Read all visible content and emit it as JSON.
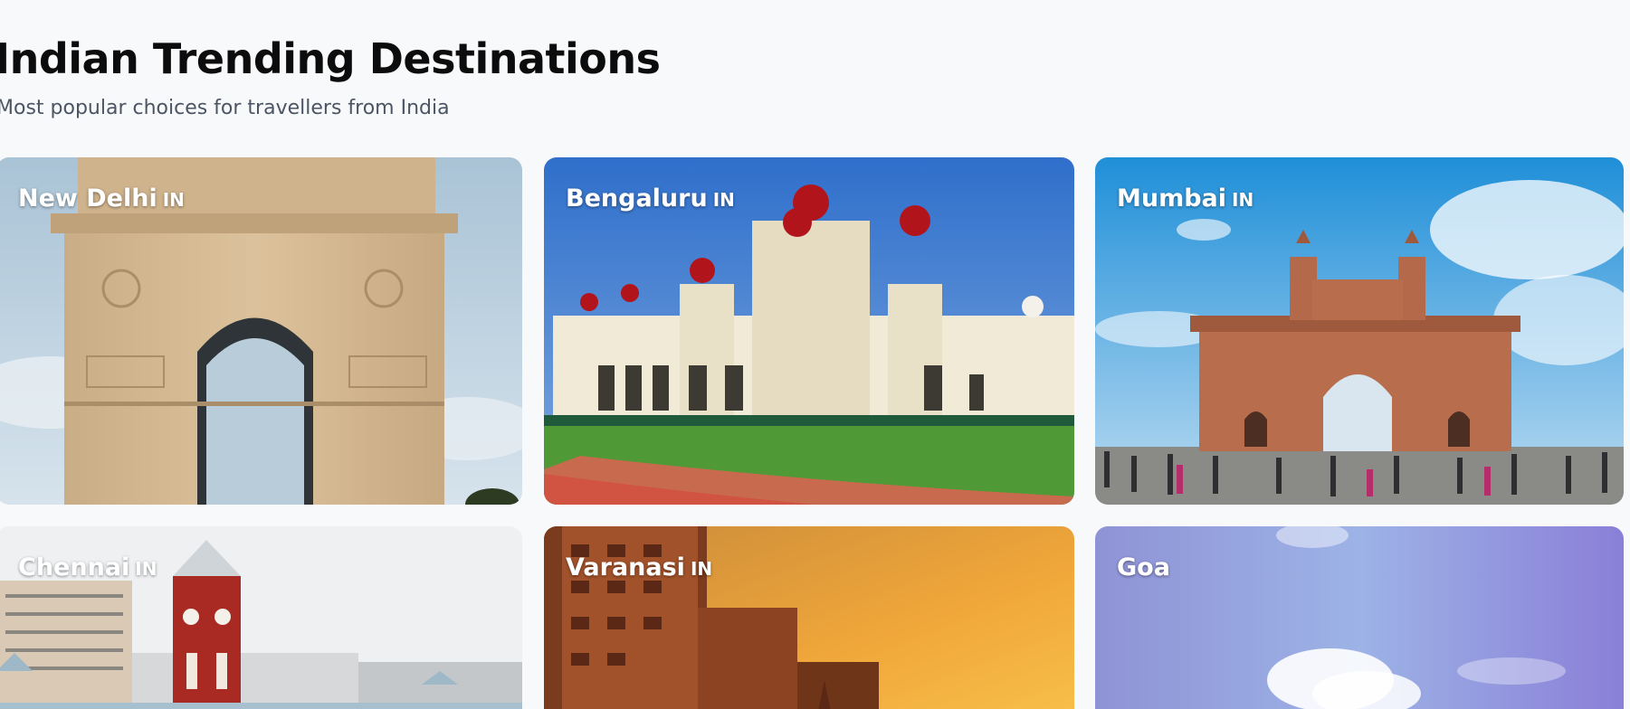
{
  "header": {
    "title": "Indian Trending Destinations",
    "subtitle": "Most popular choices for travellers from India"
  },
  "destinations": [
    {
      "name": "New Delhi",
      "country": "IN",
      "image_icon": "india-gate-image"
    },
    {
      "name": "Bengaluru",
      "country": "IN",
      "image_icon": "mysore-palace-image"
    },
    {
      "name": "Mumbai",
      "country": "IN",
      "image_icon": "gateway-of-india-image"
    },
    {
      "name": "Chennai",
      "country": "IN",
      "image_icon": "chennai-central-clock-tower-image"
    },
    {
      "name": "Varanasi",
      "country": "IN",
      "image_icon": "varanasi-ghats-image"
    },
    {
      "name": "Goa",
      "country": "",
      "image_icon": "goa-sky-image"
    }
  ],
  "colors": {
    "page_background": "#f8f9fb",
    "title": "#0c0c0c",
    "subtitle": "#4b5563",
    "card_label": "#ffffff"
  }
}
